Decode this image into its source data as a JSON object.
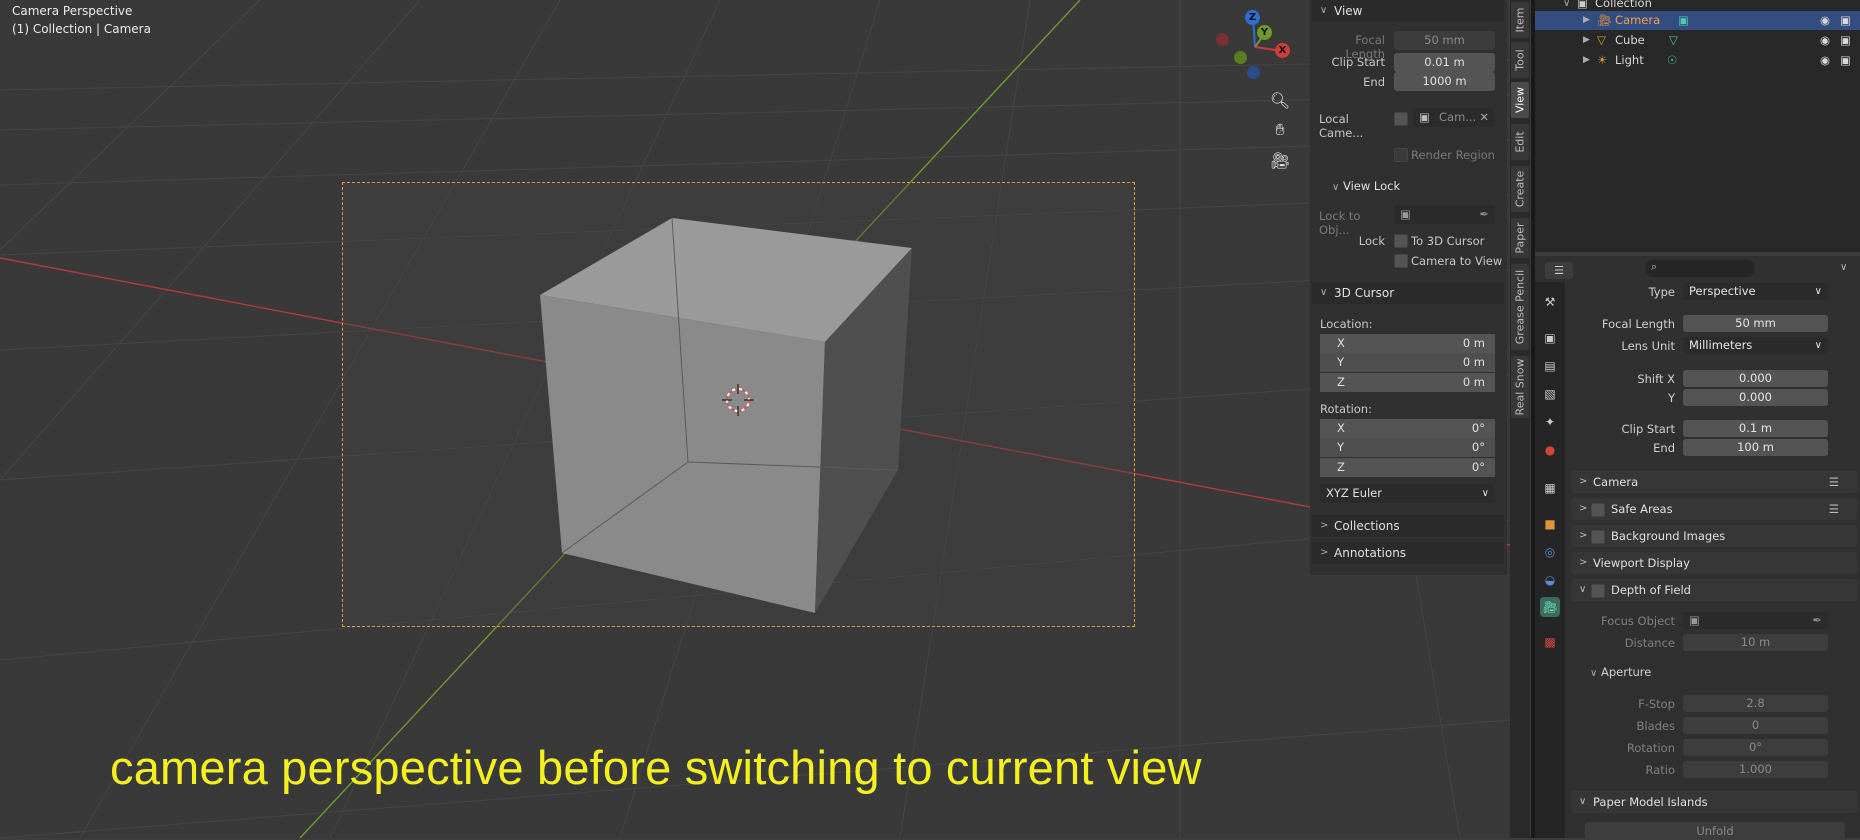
{
  "viewport": {
    "title": "Camera Perspective",
    "subtitle": "(1) Collection | Camera",
    "caption": "camera perspective before switching to current view",
    "gizmo": {
      "z": "Z",
      "y": "Y",
      "x": "X"
    }
  },
  "npanel": {
    "view": {
      "header": "View",
      "focal_length_label": "Focal Length",
      "focal_length": "50 mm",
      "clip_start_label": "Clip Start",
      "clip_start": "0.01 m",
      "clip_end_label": "End",
      "clip_end": "1000 m",
      "local_camera_label": "Local Came...",
      "local_camera_value": "Cam...",
      "render_region_label": "Render Region"
    },
    "view_lock": {
      "header": "View Lock",
      "lock_to_obj_label": "Lock to Obj...",
      "lock_label": "Lock",
      "to_3d_cursor": "To 3D Cursor",
      "camera_to_view": "Camera to View"
    },
    "cursor": {
      "header": "3D Cursor",
      "location_label": "Location:",
      "location": [
        {
          "k": "X",
          "v": "0 m"
        },
        {
          "k": "Y",
          "v": "0 m"
        },
        {
          "k": "Z",
          "v": "0 m"
        }
      ],
      "rotation_label": "Rotation:",
      "rotation": [
        {
          "k": "X",
          "v": "0°"
        },
        {
          "k": "Y",
          "v": "0°"
        },
        {
          "k": "Z",
          "v": "0°"
        }
      ],
      "rotation_mode": "XYZ Euler"
    },
    "collections": "Collections",
    "annotations": "Annotations"
  },
  "tabs": [
    "Item",
    "Tool",
    "View",
    "Edit",
    "Create",
    "Paper",
    "Grease Pencil",
    "Real Snow"
  ],
  "outliner": {
    "collection": "Collection",
    "items": [
      {
        "name": "Camera",
        "selected": true
      },
      {
        "name": "Cube",
        "selected": false
      },
      {
        "name": "Light",
        "selected": false
      }
    ]
  },
  "properties": {
    "type_label": "Type",
    "type_value": "Perspective",
    "focal_length_label": "Focal Length",
    "focal_length": "50 mm",
    "lens_unit_label": "Lens Unit",
    "lens_unit": "Millimeters",
    "shift_x_label": "Shift X",
    "shift_x": "0.000",
    "shift_y_label": "Y",
    "shift_y": "0.000",
    "clip_start_label": "Clip Start",
    "clip_start": "0.1 m",
    "clip_end_label": "End",
    "clip_end": "100 m",
    "sections": {
      "camera": "Camera",
      "safe_areas": "Safe Areas",
      "background_images": "Background Images",
      "viewport_display": "Viewport Display",
      "depth_of_field": "Depth of Field",
      "aperture": "Aperture",
      "paper_model_islands": "Paper Model Islands"
    },
    "focus_object_label": "Focus Object",
    "distance_label": "Distance",
    "distance": "10 m",
    "fstop_label": "F-Stop",
    "fstop": "2.8",
    "blades_label": "Blades",
    "blades": "0",
    "rotation_label": "Rotation",
    "rotation": "0°",
    "ratio_label": "Ratio",
    "ratio": "1.000",
    "unfold_button": "Unfold"
  },
  "colors": {
    "accent_orange": "#e89a3c",
    "selection_blue": "#334d80",
    "caption_yellow": "#f4f01e",
    "x_axis_red": "#b23a3a",
    "y_axis_green": "#6f9a2a"
  }
}
